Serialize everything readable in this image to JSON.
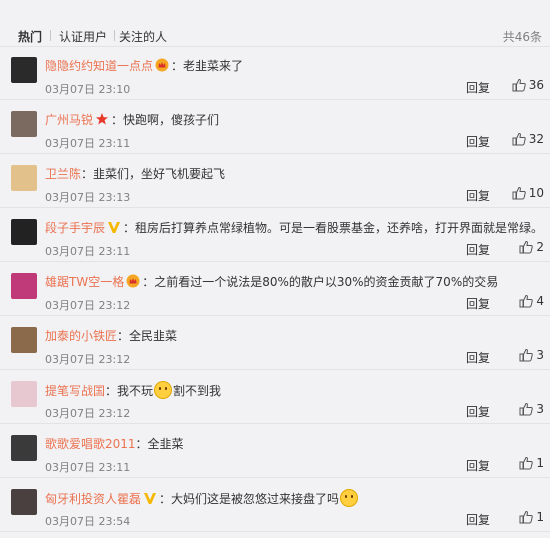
{
  "tabs": [
    {
      "label": "热门"
    },
    {
      "label": "认证用户"
    },
    {
      "label": "关注的人"
    }
  ],
  "total_label": "共46条",
  "reply_label": "回复",
  "comments": [
    {
      "user": "隐隐约约知道一点点",
      "badge": "crown-icon",
      "text": "：老韭菜来了",
      "time": "03月07日 23:10",
      "likes": "36",
      "avatar_color": "#2a2a2a"
    },
    {
      "user": "广州马锐",
      "badge": "star-icon",
      "text": "：快跑啊，傻孩子们",
      "time": "03月07日 23:11",
      "likes": "32",
      "avatar_color": "#7a6a60"
    },
    {
      "user": "卫兰陈",
      "badge": "",
      "text": "：韭菜们，坐好飞机要起飞",
      "time": "03月07日 23:13",
      "likes": "10",
      "avatar_color": "#e2c28a"
    },
    {
      "user": "段子手宇辰",
      "badge": "v-icon",
      "text": "：租房后打算养点常绿植物。可是一看股票基金，还养啥，打开界面就是常绿。",
      "time": "03月07日 23:11",
      "likes": "2",
      "avatar_color": "#222222"
    },
    {
      "user": "雄踞TW空一格",
      "badge": "crown-icon",
      "text": "：之前看过一个说法是80%的散户以30%的资金贡献了70%的交易",
      "time": "03月07日 23:12",
      "likes": "4",
      "avatar_color": "#c03a7a"
    },
    {
      "user": "加泰的小铁匠",
      "badge": "",
      "text": "：全民韭菜",
      "time": "03月07日 23:12",
      "likes": "3",
      "avatar_color": "#8a6a4a"
    },
    {
      "user": "提笔写战国",
      "badge": "",
      "text_before": "：我不玩",
      "text_after": "割不到我",
      "emoji": "smile-emoji",
      "time": "03月07日 23:12",
      "likes": "3",
      "avatar_color": "#e8c8d0"
    },
    {
      "user": "歌歌爱唱歌2011",
      "badge": "",
      "text": "：全韭菜",
      "time": "03月07日 23:11",
      "likes": "1",
      "avatar_color": "#3a3a3a"
    },
    {
      "user": "匈牙利投资人瞿磊",
      "badge": "v-icon",
      "text_before": "：大妈们这是被忽悠过来接盘了吗",
      "text_after": "",
      "emoji": "laugh-emoji",
      "time": "03月07日 23:54",
      "likes": "1",
      "avatar_color": "#4a4040"
    }
  ],
  "colors": {
    "username": "#eb7350",
    "muted": "#808080",
    "background": "#f2f2f5"
  }
}
